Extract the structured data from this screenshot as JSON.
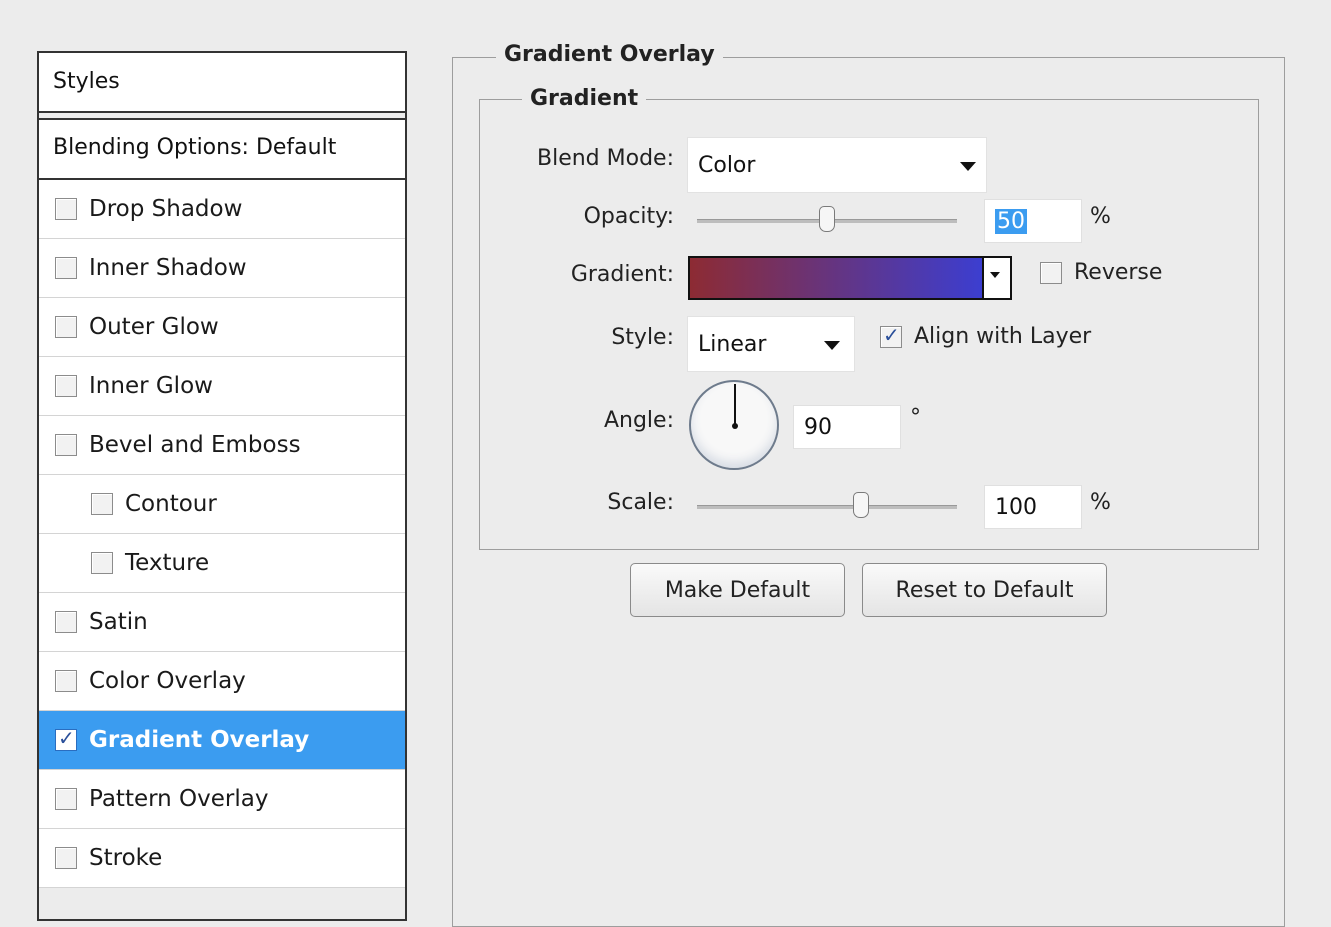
{
  "styles_panel": {
    "header": "Styles",
    "blending_options": "Blending Options: Default",
    "items": [
      {
        "label": "Drop Shadow",
        "checked": false,
        "indent": false,
        "selected": false
      },
      {
        "label": "Inner Shadow",
        "checked": false,
        "indent": false,
        "selected": false
      },
      {
        "label": "Outer Glow",
        "checked": false,
        "indent": false,
        "selected": false
      },
      {
        "label": "Inner Glow",
        "checked": false,
        "indent": false,
        "selected": false
      },
      {
        "label": "Bevel and Emboss",
        "checked": false,
        "indent": false,
        "selected": false
      },
      {
        "label": "Contour",
        "checked": false,
        "indent": true,
        "selected": false
      },
      {
        "label": "Texture",
        "checked": false,
        "indent": true,
        "selected": false
      },
      {
        "label": "Satin",
        "checked": false,
        "indent": false,
        "selected": false
      },
      {
        "label": "Color Overlay",
        "checked": false,
        "indent": false,
        "selected": false
      },
      {
        "label": "Gradient Overlay",
        "checked": true,
        "indent": false,
        "selected": true
      },
      {
        "label": "Pattern Overlay",
        "checked": false,
        "indent": false,
        "selected": false
      },
      {
        "label": "Stroke",
        "checked": false,
        "indent": false,
        "selected": false
      }
    ]
  },
  "gradient_overlay": {
    "title": "Gradient Overlay",
    "group_title": "Gradient",
    "blend_mode": {
      "label": "Blend Mode:",
      "value": "Color"
    },
    "opacity": {
      "label": "Opacity:",
      "value": "50",
      "unit": "%",
      "level": 0.5
    },
    "gradient": {
      "label": "Gradient:",
      "start_color": "#8d2b33",
      "end_color": "#3c3ed0"
    },
    "reverse": {
      "label": "Reverse",
      "checked": false
    },
    "style": {
      "label": "Style:",
      "value": "Linear"
    },
    "align_with_layer": {
      "label": "Align with Layer",
      "checked": true
    },
    "angle": {
      "label": "Angle:",
      "value": "90",
      "unit": "°"
    },
    "scale": {
      "label": "Scale:",
      "value": "100",
      "unit": "%",
      "level": 0.63
    },
    "make_default": "Make Default",
    "reset_to_default": "Reset to Default"
  }
}
